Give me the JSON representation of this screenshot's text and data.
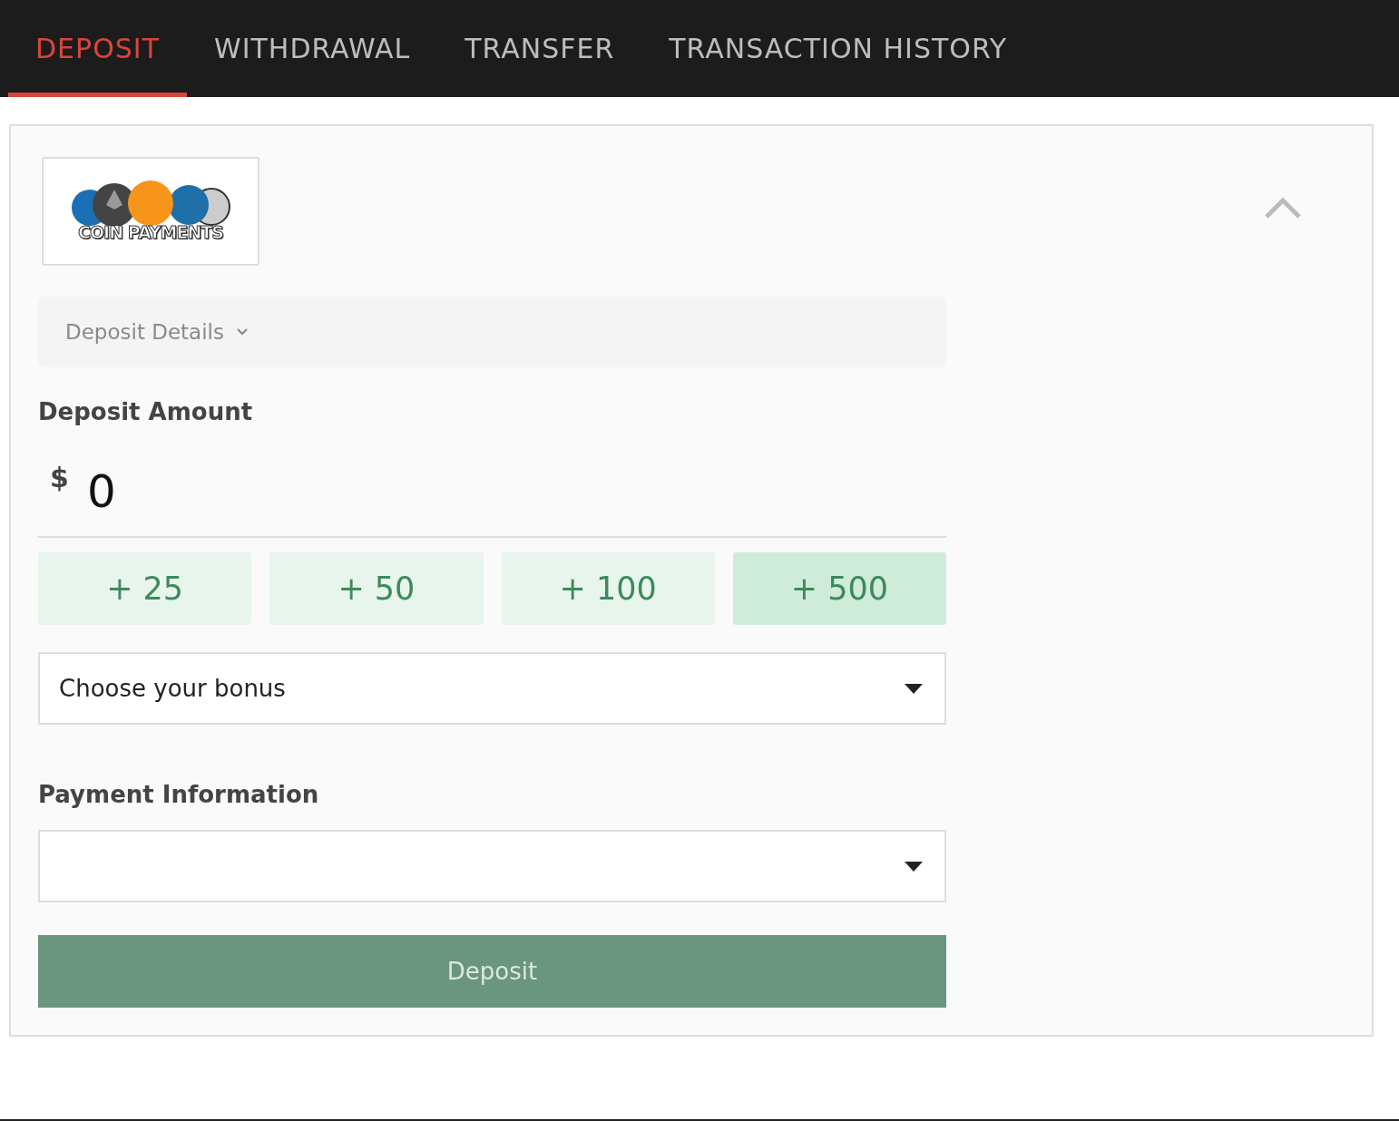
{
  "tabs": [
    {
      "label": "DEPOSIT",
      "selected": true
    },
    {
      "label": "WITHDRAWAL",
      "selected": false
    },
    {
      "label": "TRANSFER",
      "selected": false
    },
    {
      "label": "TRANSACTION HISTORY",
      "selected": false
    }
  ],
  "payment_method": {
    "logo_text": "COIN PAYMENTS",
    "expanded": true
  },
  "details": {
    "label": "Deposit Details",
    "expanded": false
  },
  "deposit_amount": {
    "heading": "Deposit Amount",
    "currency": "$",
    "value": "0"
  },
  "quick_amounts": [
    {
      "label": "+ 25",
      "selected": false
    },
    {
      "label": "+ 50",
      "selected": false
    },
    {
      "label": "+ 100",
      "selected": false
    },
    {
      "label": "+ 500",
      "selected": true
    }
  ],
  "bonus_select": {
    "placeholder": "Choose your bonus"
  },
  "payment_information": {
    "heading": "Payment Information"
  },
  "deposit_button": {
    "label": "Deposit",
    "disabled": true
  }
}
